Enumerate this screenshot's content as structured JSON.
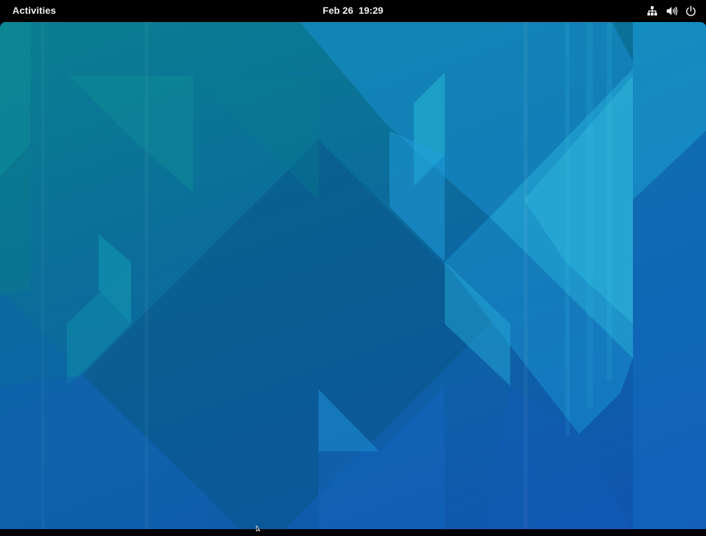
{
  "topbar": {
    "activities_label": "Activities",
    "clock_text": "Feb 26  19:29",
    "tray_icons": [
      "network-icon",
      "volume-icon",
      "power-icon"
    ]
  },
  "desktop": {
    "wallpaper": "blue geometric wallpaper"
  },
  "colors": {
    "topbar_bg": "#000000",
    "topbar_text": "#f0f0f0",
    "wallpaper_teal": "#0a7f90",
    "wallpaper_blue": "#1153b0",
    "wallpaper_cyan": "#27c3e6"
  }
}
